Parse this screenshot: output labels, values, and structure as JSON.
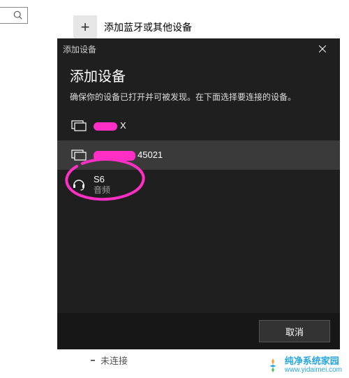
{
  "bg": {
    "heading_fragment": "",
    "add_device_label": "添加蓝牙或其他设备",
    "status_text": "未连接"
  },
  "dialog": {
    "window_title": "添加设备",
    "heading": "添加设备",
    "subtitle": "确保你的设备已打开并可被发现。在下面选择要连接的设备。",
    "devices": [
      {
        "name_suffix": "X",
        "subtype": ""
      },
      {
        "name_suffix": "45021",
        "subtype": ""
      },
      {
        "name": "S6",
        "subtype": "音频"
      }
    ],
    "cancel": "取消"
  },
  "watermark": {
    "cn": "纯净系统家园",
    "url": "www.yidaimei.com"
  }
}
